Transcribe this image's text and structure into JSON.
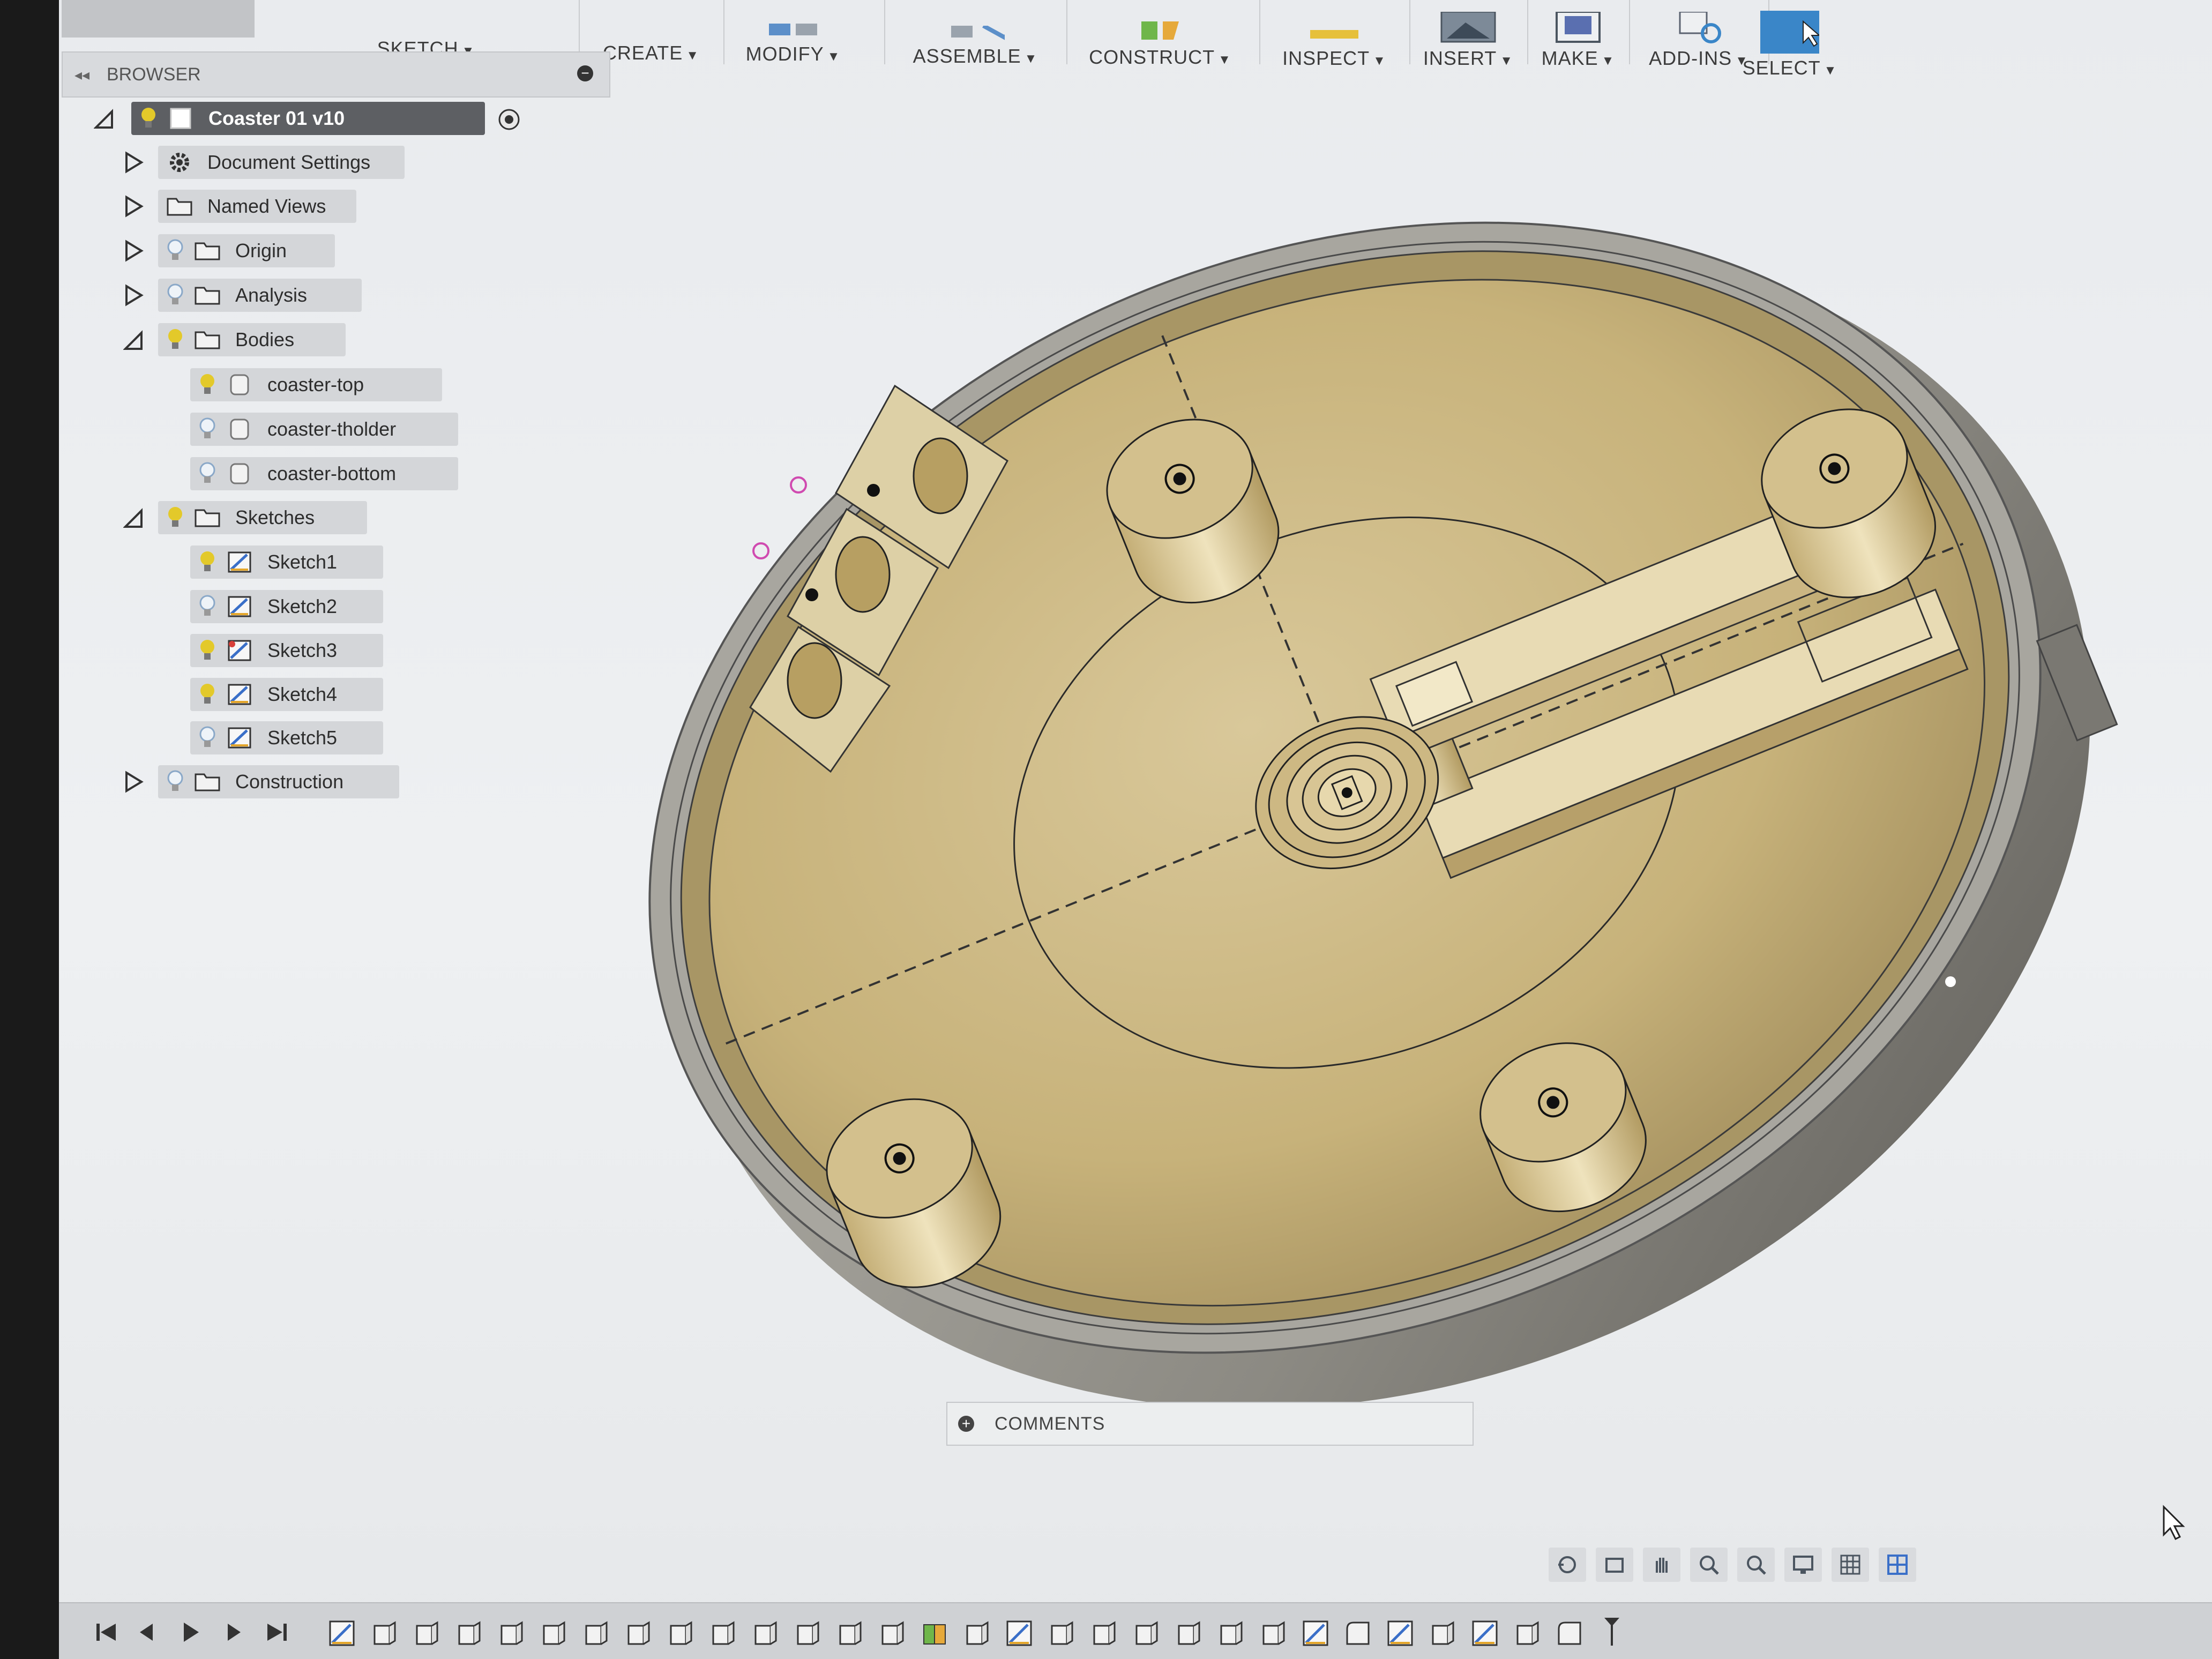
{
  "toolbar": {
    "groups": [
      {
        "label": "SKETCH",
        "icon": "sketch-icon"
      },
      {
        "label": "CREATE",
        "icon": "create-icon"
      },
      {
        "label": "MODIFY",
        "icon": "modify-icon"
      },
      {
        "label": "ASSEMBLE",
        "icon": "assemble-icon"
      },
      {
        "label": "CONSTRUCT",
        "icon": "construct-icon"
      },
      {
        "label": "INSPECT",
        "icon": "inspect-icon"
      },
      {
        "label": "INSERT",
        "icon": "insert-icon"
      },
      {
        "label": "MAKE",
        "icon": "make-icon"
      },
      {
        "label": "ADD-INS",
        "icon": "add-ins-icon"
      },
      {
        "label": "SELECT",
        "icon": "select-icon"
      }
    ]
  },
  "browser": {
    "title": "BROWSER",
    "root": {
      "label": "Coaster 01 v10"
    },
    "items": [
      {
        "label": "Document Settings",
        "icon": "gear-icon"
      },
      {
        "label": "Named Views",
        "icon": "folder-icon"
      },
      {
        "label": "Origin",
        "icon": "folder-icon"
      },
      {
        "label": "Analysis",
        "icon": "folder-icon"
      },
      {
        "label": "Bodies",
        "icon": "folder-icon"
      },
      {
        "label": "coaster-top",
        "icon": "body-icon"
      },
      {
        "label": "coaster-tholder",
        "icon": "body-icon"
      },
      {
        "label": "coaster-bottom",
        "icon": "body-icon"
      },
      {
        "label": "Sketches",
        "icon": "folder-icon"
      },
      {
        "label": "Sketch1",
        "icon": "sketch-icon"
      },
      {
        "label": "Sketch2",
        "icon": "sketch-icon"
      },
      {
        "label": "Sketch3",
        "icon": "sketch-icon"
      },
      {
        "label": "Sketch4",
        "icon": "sketch-icon"
      },
      {
        "label": "Sketch5",
        "icon": "sketch-icon"
      },
      {
        "label": "Construction",
        "icon": "folder-icon"
      }
    ]
  },
  "comments": {
    "label": "COMMENTS"
  },
  "colors": {
    "accent_select": "#3a86c8",
    "bulb_on": "#e3c92a",
    "body_tan": "#c9b37c",
    "rim_grey": "#8f8d86"
  }
}
